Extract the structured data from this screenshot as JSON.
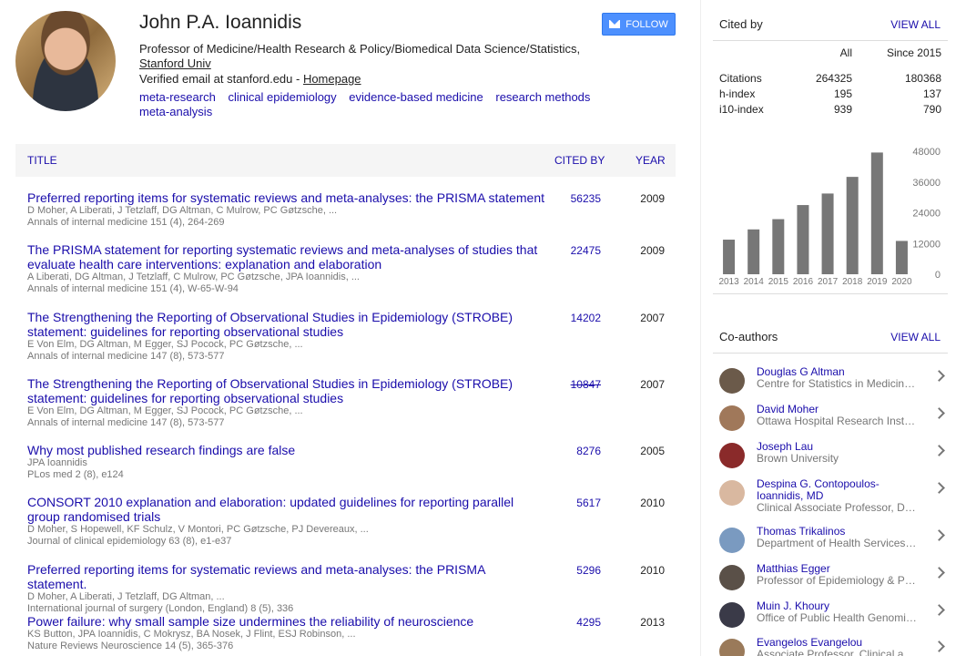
{
  "profile": {
    "name": "John P.A. Ioannidis",
    "affiliation": "Professor of Medicine/Health Research & Policy/Biomedical Data Science/Statistics,",
    "institution": "Stanford Univ",
    "email_prefix": "Verified email at stanford.edu - ",
    "homepage": "Homepage",
    "follow_label": "FOLLOW",
    "interests": [
      "meta-research",
      "clinical epidemiology",
      "evidence-based medicine",
      "research methods",
      "meta-analysis"
    ]
  },
  "table": {
    "col_title": "TITLE",
    "col_cited": "CITED BY",
    "col_year": "YEAR",
    "rows": [
      {
        "title": "Preferred reporting items for systematic reviews and meta-analyses: the PRISMA statement",
        "authors": "D Moher, A Liberati, J Tetzlaff, DG Altman, C Mulrow, PC Gøtzsche, ...",
        "venue": "Annals of internal medicine 151 (4), 264-269",
        "cited": "56235",
        "year": "2009"
      },
      {
        "title": "The PRISMA statement for reporting systematic reviews and meta-analyses of studies that evaluate health care interventions: explanation and elaboration",
        "authors": "A Liberati, DG Altman, J Tetzlaff, C Mulrow, PC Gøtzsche, JPA Ioannidis, ...",
        "venue": "Annals of internal medicine 151 (4), W-65-W-94",
        "cited": "22475",
        "year": "2009"
      },
      {
        "title": "The Strengthening the Reporting of Observational Studies in Epidemiology (STROBE) statement: guidelines for reporting observational studies",
        "authors": "E Von Elm, DG Altman, M Egger, SJ Pocock, PC Gøtzsche, ...",
        "venue": "Annals of internal medicine 147 (8), 573-577",
        "cited": "14202",
        "year": "2007"
      },
      {
        "title": "The Strengthening the Reporting of Observational Studies in Epidemiology (STROBE) statement: guidelines for reporting observational studies",
        "authors": "E Von Elm, DG Altman, M Egger, SJ Pocock, PC Gøtzsche, ...",
        "venue": "Annals of internal medicine 147 (8), 573-577",
        "cited": "10847",
        "year": "2007",
        "struck": true
      },
      {
        "title": "Why most published research findings are false",
        "authors": "JPA Ioannidis",
        "venue": "PLos med 2 (8), e124",
        "cited": "8276",
        "year": "2005"
      },
      {
        "title": "CONSORT 2010 explanation and elaboration: updated guidelines for reporting parallel group randomised trials",
        "authors": "D Moher, S Hopewell, KF Schulz, V Montori, PC Gøtzsche, PJ Devereaux, ...",
        "venue": "Journal of clinical epidemiology 63 (8), e1-e37",
        "cited": "5617",
        "year": "2010"
      },
      {
        "title": "Preferred reporting items for systematic reviews and meta-analyses: the PRISMA statement.",
        "authors": "D Moher, A Liberati, J Tetzlaff, DG Altman, ...",
        "venue": "International journal of surgery (London, England) 8 (5), 336",
        "cited": "5296",
        "year": "2010"
      },
      {
        "title": "Power failure: why small sample size undermines the reliability of neuroscience",
        "authors": "KS Button, JPA Ioannidis, C Mokrysz, BA Nosek, J Flint, ESJ Robinson, ...",
        "venue": "Nature Reviews Neuroscience 14 (5), 365-376",
        "cited": "4295",
        "year": "2013"
      }
    ]
  },
  "cited_by": {
    "heading": "Cited by",
    "view_all": "VIEW ALL",
    "col_all": "All",
    "col_since": "Since 2015",
    "stats": [
      {
        "label": "Citations",
        "all": "264325",
        "since": "180368"
      },
      {
        "label": "h-index",
        "all": "195",
        "since": "137"
      },
      {
        "label": "i10-index",
        "all": "939",
        "since": "790"
      }
    ]
  },
  "chart_data": {
    "type": "bar",
    "categories": [
      "2013",
      "2014",
      "2015",
      "2016",
      "2017",
      "2018",
      "2019",
      "2020"
    ],
    "values": [
      13500,
      17500,
      21500,
      27000,
      31500,
      38000,
      47500,
      13000
    ],
    "yticks": [
      "48000",
      "36000",
      "24000",
      "12000",
      "0"
    ],
    "ylim": [
      0,
      48000
    ],
    "bar_color": "#777777"
  },
  "coauthors": {
    "heading": "Co-authors",
    "view_all": "VIEW ALL",
    "items": [
      {
        "name": "Douglas G Altman",
        "affil": "Centre for Statistics in Medicine, ...",
        "color": "#6b5a4a"
      },
      {
        "name": "David Moher",
        "affil": "Ottawa Hospital Research Institute",
        "color": "#a0785a"
      },
      {
        "name": "Joseph Lau",
        "affil": "Brown University",
        "color": "#8a2a2a"
      },
      {
        "name": "Despina G. Contopoulos-Ioannidis, MD",
        "affil": "Clinical Associate Professor, Dep...",
        "color": "#d9b8a0"
      },
      {
        "name": "Thomas Trikalinos",
        "affil": "Department of Health Services, ...",
        "color": "#7a9ac0"
      },
      {
        "name": "Matthias Egger",
        "affil": "Professor of Epidemiology & Pub...",
        "color": "#5a5048"
      },
      {
        "name": "Muin J. Khoury",
        "affil": "Office of Public Health Genomics...",
        "color": "#3a3a48"
      },
      {
        "name": "Evangelos Evangelou",
        "affil": "Associate Professor, Clinical and ...",
        "color": "#9a7a5a"
      }
    ]
  }
}
